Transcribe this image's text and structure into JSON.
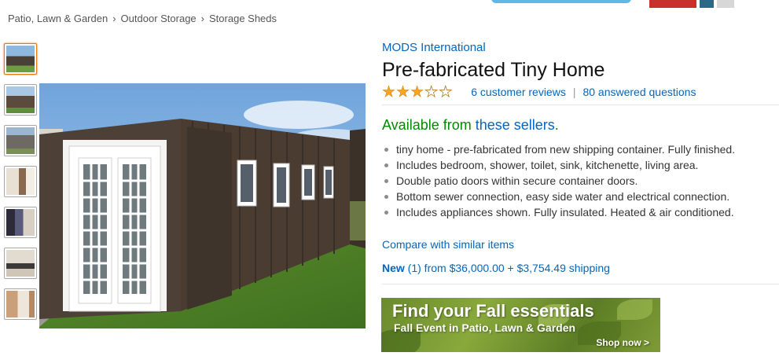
{
  "breadcrumb": [
    "Patio, Lawn & Garden",
    "Outdoor Storage",
    "Storage Sheds"
  ],
  "breadcrumb_separator": "›",
  "product": {
    "brand": "MODS International",
    "title": "Pre-fabricated Tiny Home",
    "rating_stars": 3,
    "rating_max": 5,
    "reviews_text": "6 customer reviews",
    "questions_text": "80 answered questions",
    "availability_prefix": "Available from ",
    "availability_link": "these sellers",
    "availability_suffix": ".",
    "bullets": [
      "tiny home - pre-fabricated from new shipping container. Fully finished.",
      "Includes bedroom, shower, toilet, sink, kitchenette, living area.",
      "Double patio doors within secure container doors.",
      "Bottom sewer connection, easy side water and electrical connection.",
      "Includes appliances shown. Fully insulated. Heated & air conditioned."
    ],
    "compare_text": "Compare with similar items",
    "new_label": "New",
    "new_offer_text": " (1) from $36,000.00 + $3,754.49 shipping"
  },
  "ad": {
    "title": "Find your Fall essentials",
    "subtitle": "Fall Event in Patio, Lawn & Garden",
    "cta": "Shop now >"
  },
  "colors": {
    "link": "#0066c0",
    "available": "#008a00",
    "star": "#ffa41c",
    "thumb_selected": "#e47911"
  }
}
